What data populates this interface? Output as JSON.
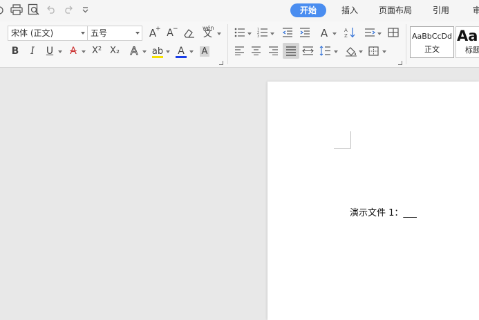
{
  "tabs": [
    {
      "label": "开始",
      "active": true
    },
    {
      "label": "插入",
      "active": false
    },
    {
      "label": "页面布局",
      "active": false
    },
    {
      "label": "引用",
      "active": false
    },
    {
      "label": "审",
      "active": false
    }
  ],
  "font": {
    "family_value": "宋体 (正文)",
    "size_value": "五号"
  },
  "format_glyphs": {
    "bold": "B",
    "italic": "I",
    "underline": "U",
    "strike": "A",
    "superscript": "X²",
    "subscript": "X₂",
    "text_effect": "A",
    "highlight": "ab",
    "font_color": "A",
    "char_shading": "A",
    "grow_font": "A",
    "shrink_font": "A",
    "phonetic": "wén",
    "phonetic_char": "文",
    "wrap": "A"
  },
  "colors": {
    "accent": "#4a8df0",
    "highlight": "#f5e000",
    "font_color": "#1a3ee8"
  },
  "styles": [
    {
      "preview": "AaBbCcDd",
      "name": "正文"
    },
    {
      "preview": "Aa",
      "name": "标题"
    }
  ],
  "document": {
    "text": "演示文件 1：___"
  }
}
